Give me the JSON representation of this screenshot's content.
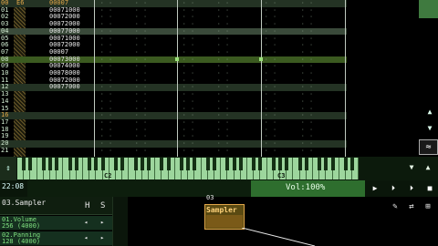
{
  "pattern": {
    "row_numbers": [
      "00",
      "01",
      "02",
      "03",
      "04",
      "05",
      "06",
      "07",
      "08",
      "09",
      "10",
      "11",
      "12",
      "13",
      "14",
      "15",
      "16",
      "17",
      "18",
      "19",
      "20",
      "21"
    ],
    "top_note": "E6",
    "rows": [
      {
        "value": "00007",
        "orange": true
      },
      {
        "value": "00071000"
      },
      {
        "value": "00072000"
      },
      {
        "value": "00072000"
      },
      {
        "value": "00077000"
      },
      {
        "value": "00071000"
      },
      {
        "value": "00072000"
      },
      {
        "value": "00007"
      },
      {
        "value": "00073000"
      },
      {
        "value": "00074000"
      },
      {
        "value": "00078000"
      },
      {
        "value": "00072000"
      },
      {
        "value": "00077000"
      }
    ]
  },
  "right_panel": {
    "up_arrow": "▲",
    "down_arrow": "▼",
    "wave_icon": "≈"
  },
  "keyboard": {
    "left_arrow": "⇕",
    "octaves": [
      "C2",
      "C3"
    ],
    "buttons": [
      "▼",
      "▲",
      "⊟"
    ]
  },
  "status": {
    "time": "22:08",
    "volume": "Vol:100%",
    "transport": [
      "▶",
      "⏵",
      "⏵",
      "■"
    ]
  },
  "instrument": {
    "name": "03.Sampler",
    "h_label": "H",
    "s_label": "S",
    "params": [
      {
        "name": "01.Volume",
        "value": "256 (4000)"
      },
      {
        "name": "02.Panning",
        "value": "128 (4000)"
      }
    ]
  },
  "module": {
    "number": "03",
    "name": "Sampler"
  },
  "tools": [
    "✎",
    "⇄",
    "⊞"
  ]
}
